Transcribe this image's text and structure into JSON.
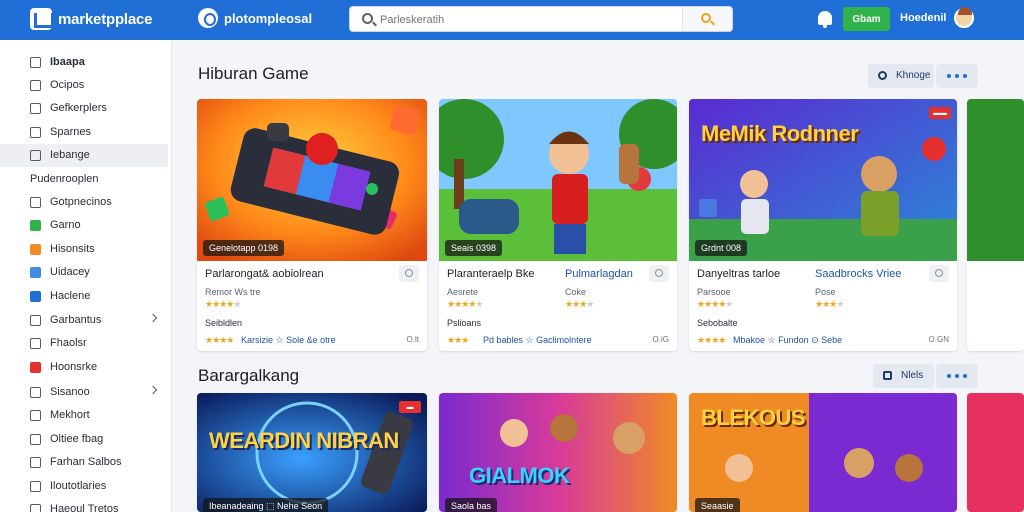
{
  "header": {
    "brand": "marketpplace",
    "store": "plotompleosal",
    "search_placeholder": "Parleskeratih",
    "signin_label": "Gbam",
    "username": "Hoedenil"
  },
  "sidebar": {
    "items": [
      {
        "label": "Ibaapa",
        "bold": true,
        "icon": "home-icon"
      },
      {
        "label": "Ocipos",
        "icon": "list-icon"
      },
      {
        "label": "Gefkerplers",
        "icon": "tag-icon"
      },
      {
        "label": "Sparnes",
        "icon": "store-icon"
      },
      {
        "label": "Iebange",
        "icon": "gamepad-icon",
        "active": true
      },
      {
        "label": "Pudenrooplen",
        "section": true
      },
      {
        "label": "Gotpnecinos",
        "icon": "grid-icon"
      },
      {
        "label": "Garno",
        "icon": "green-icon",
        "color": "#2fb34a"
      },
      {
        "label": "Hisonsits",
        "icon": "orange-icon",
        "color": "#f08a24"
      },
      {
        "label": "Uidacey",
        "icon": "blue-icon",
        "color": "#3f8de0"
      },
      {
        "label": "Haclene",
        "icon": "navy-icon",
        "color": "#1f6fd6"
      },
      {
        "label": "Garbantus",
        "icon": "folder-icon",
        "chevron": true
      },
      {
        "label": "Fhaolsr",
        "icon": "bookmark-icon"
      },
      {
        "label": "Hoonsrke",
        "icon": "red-icon",
        "color": "#e53030"
      },
      {
        "label": "Sisanoo",
        "icon": "chat-icon",
        "chevron": true
      },
      {
        "label": "Mekhort",
        "icon": "cart-icon"
      },
      {
        "label": "Oltiee fbag",
        "icon": "box-icon"
      },
      {
        "label": "Farhan Salbos",
        "icon": "card-icon"
      },
      {
        "label": "Iloutotlaries",
        "icon": "doc-icon"
      },
      {
        "label": "Haeoul Tretos",
        "icon": "settings-icon"
      }
    ]
  },
  "sections": [
    {
      "title": "Hiburan Game",
      "pill_label": "Khnoge",
      "cards": [
        {
          "tag": "Genelotapp 0198",
          "title": "Parlarongat& aobiolrean",
          "title2": "",
          "sub": "Remor Ws tre",
          "sub2": "",
          "seller": "Seibldlen",
          "meta": "Karsizie ☆ Sole &e otre",
          "price": "O.lt"
        },
        {
          "tag": "Seais 0398",
          "title": "Plaranteraelp Bke",
          "title2": "Pulmarlagdan",
          "sub": "Aesrete",
          "sub2": "Coke",
          "seller": "Pslioans",
          "meta": "Pd bables ☆ Gaclimolntere",
          "price": "O.iG"
        },
        {
          "tag": "Grdnt 008",
          "title": "Danyeltras tarloe",
          "title2": "Saadbrocks Vriee",
          "sub": "Parsooe",
          "sub2": "Pose",
          "seller": "Sebobalte",
          "meta": "Mbakoe ☆ Fundon ⊙ Sebe",
          "price": "O.GN",
          "badge": "▬▬",
          "thumb_title": "MeMik Rodnner"
        }
      ]
    },
    {
      "title": "Barargalkang",
      "pill_label": "Nlels",
      "cards": [
        {
          "tag": "Ibeanadeaing ⬚ Nehe Seon",
          "badge": "▬",
          "thumb_title": "WEARDIN NIBRAN"
        },
        {
          "tag": "Saola bas",
          "thumb_title": "GIALMOK"
        },
        {
          "tag": "Seaasie",
          "thumb_title": "BLEKOUS"
        }
      ]
    }
  ],
  "colors": {
    "accent": "#1f6fd6",
    "success": "#2fb34a",
    "star": "#f2a516"
  }
}
